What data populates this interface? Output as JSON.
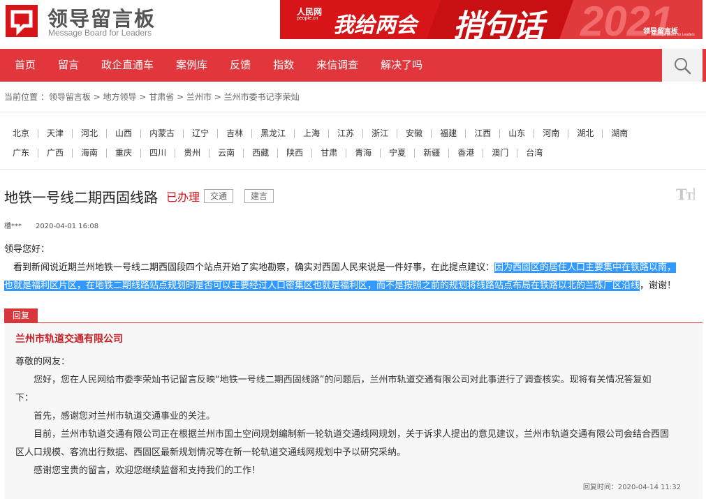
{
  "header": {
    "logo_cn": "领导留言板",
    "logo_en": "Message Board for Leaders",
    "banner": {
      "site_small": "人民网",
      "site_small_en": "people.cn",
      "title_part1": "我给两会",
      "title_part2": "捎句话",
      "year": "2021",
      "brand": "领导留言板",
      "brand_en": "Message Board for Leaders"
    }
  },
  "nav": {
    "items": [
      "首页",
      "留言",
      "政企直通车",
      "案例库",
      "反馈",
      "指数",
      "来信调查",
      "解决了吗"
    ]
  },
  "breadcrumb": {
    "prefix": "当前位置 ：",
    "items": [
      "领导留言板",
      "地方领导",
      "甘肃省",
      "兰州市",
      "兰州市委书记李荣灿"
    ],
    "separator": " > "
  },
  "provinces": {
    "row1": [
      "北京",
      "天津",
      "河北",
      "山西",
      "内蒙古",
      "辽宁",
      "吉林",
      "黑龙江",
      "上海",
      "江苏",
      "浙江",
      "安徽",
      "福建",
      "江西",
      "山东",
      "河南",
      "湖北",
      "湖南"
    ],
    "row2": [
      "广东",
      "广西",
      "海南",
      "重庆",
      "四川",
      "贵州",
      "云南",
      "西藏",
      "陕西",
      "甘肃",
      "青海",
      "宁夏",
      "新疆",
      "香港",
      "澳门",
      "台湾"
    ]
  },
  "message": {
    "title": "地铁一号线二期西固线路",
    "status": "已办理",
    "tags": [
      "交通",
      "建言"
    ],
    "author": "槽***",
    "date": "2020-04-01 16:08",
    "greeting": "领导您好：",
    "line1_plain": "看到新闻说近期兰州地铁一号线二期西固段四个站点开始了实地勘察，确实对西固人民来说是一件好事，在此提点建议：",
    "line1_highlight": "因为西固区的居住人口主要集中在铁路以南，",
    "line2_highlight": "也就是福利区片区，在地铁二期线路站点规划时是否可以主要经过人口密集区也就是福利区，而不是按照之前的规划将线路站点布局在铁路以北的兰炼厂区沿线",
    "line2_plain": "，谢谢！"
  },
  "reply": {
    "tab_label": "回复",
    "org": "兰州市轨道交通有限公司",
    "salutation": "尊敬的网友：",
    "p1_line1": "您好，您在人民网给市委李荣灿书记留言反映“地铁一号线二期西固线路”的问题后，兰州市轨道交通有限公司对此事进行了调查核实。现将有关情况答复如",
    "p1_line2": "下：",
    "p2": "首先，感谢您对兰州市轨道交通事业的关注。",
    "p3_line1": "目前，兰州市轨道交通有限公司正在根据兰州市国土空间规划编制新一轮轨道交通线网规划，关于诉求人提出的意见建议，兰州市轨道交通有限公司会结合西固",
    "p3_line2": "区人口规模、客流出行数据、西固区最新规划情况等在新一轮轨道交通线网规划中予以研究采纳。",
    "p4": "感谢您宝贵的留言，欢迎您继续监督和支持我们的工作！",
    "time": "回复时间：2020-04-14 11:32"
  },
  "colors": {
    "nav_red": "#e2363d",
    "brand_red": "#d71518",
    "highlight": "#3399ff"
  },
  "icons": {
    "search": "search-icon",
    "font_size": "font-size-icon",
    "logo": "logo-icon"
  }
}
